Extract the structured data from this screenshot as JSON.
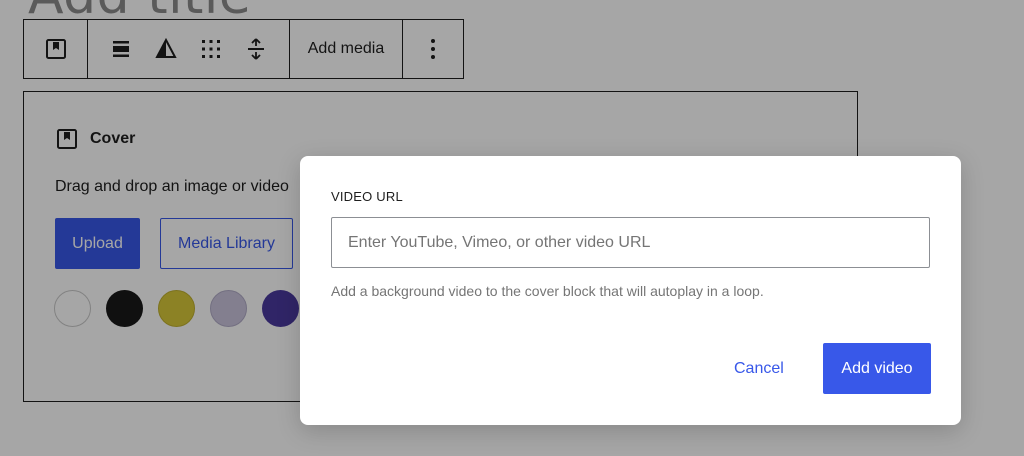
{
  "page": {
    "title_placeholder": "Add title"
  },
  "toolbar": {
    "add_media_label": "Add media",
    "icons": [
      "bookmark-icon",
      "align-icon",
      "duotone-icon",
      "matrix-icon",
      "height-icon",
      "more-options-icon"
    ]
  },
  "cover_block": {
    "title": "Cover",
    "instructions": "Drag and drop an image or video",
    "upload_label": "Upload",
    "media_library_label": "Media Library",
    "swatches": [
      "#ffffff",
      "#1a1a1a",
      "#d8c83a",
      "#c9c4dc",
      "#4b3a9e"
    ]
  },
  "modal": {
    "label": "VIDEO URL",
    "input_value": "",
    "input_placeholder": "Enter YouTube, Vimeo, or other video URL",
    "help_text": "Add a background video to the cover block that will autoplay in a loop.",
    "cancel_label": "Cancel",
    "submit_label": "Add video"
  },
  "colors": {
    "accent": "#3858e9",
    "text": "#1e1e1e",
    "muted": "#757575"
  }
}
